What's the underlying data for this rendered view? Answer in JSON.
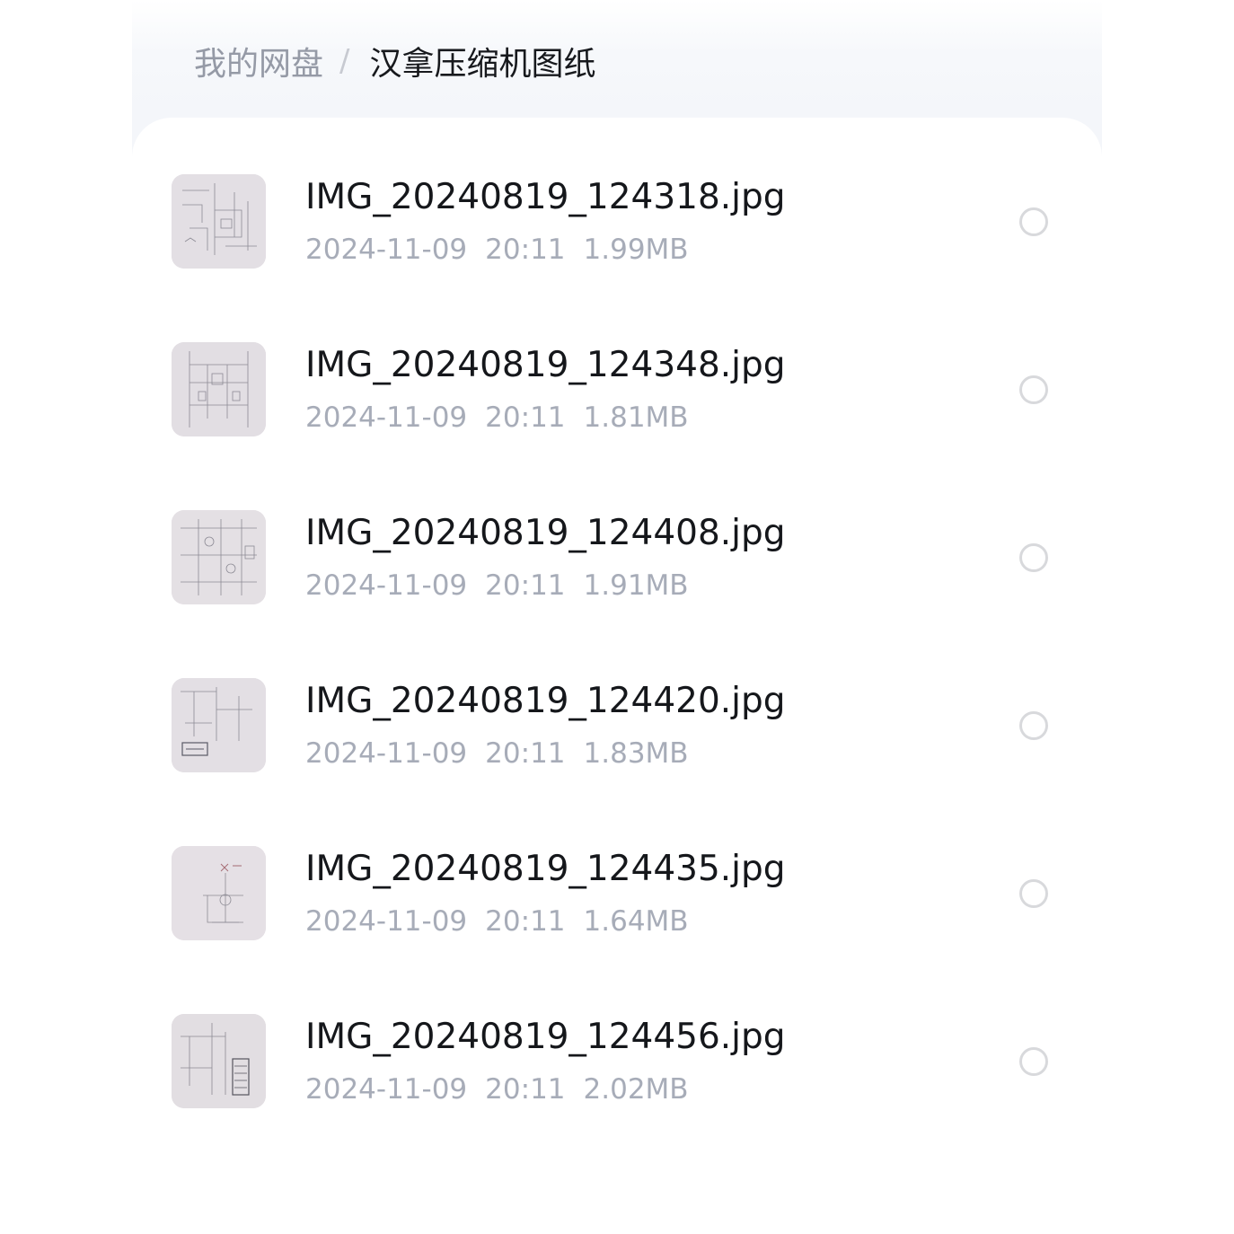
{
  "breadcrumb": {
    "root": "我的网盘",
    "separator": "/",
    "current": "汉拿压缩机图纸"
  },
  "files": [
    {
      "name": "IMG_20240819_124318.jpg",
      "date": "2024-11-09",
      "time": "20:11",
      "size": "1.99MB",
      "thumbnail_icon": "image-thumbnail"
    },
    {
      "name": "IMG_20240819_124348.jpg",
      "date": "2024-11-09",
      "time": "20:11",
      "size": "1.81MB",
      "thumbnail_icon": "image-thumbnail"
    },
    {
      "name": "IMG_20240819_124408.jpg",
      "date": "2024-11-09",
      "time": "20:11",
      "size": "1.91MB",
      "thumbnail_icon": "image-thumbnail"
    },
    {
      "name": "IMG_20240819_124420.jpg",
      "date": "2024-11-09",
      "time": "20:11",
      "size": "1.83MB",
      "thumbnail_icon": "image-thumbnail"
    },
    {
      "name": "IMG_20240819_124435.jpg",
      "date": "2024-11-09",
      "time": "20:11",
      "size": "1.64MB",
      "thumbnail_icon": "image-thumbnail"
    },
    {
      "name": "IMG_20240819_124456.jpg",
      "date": "2024-11-09",
      "time": "20:11",
      "size": "2.02MB",
      "thumbnail_icon": "image-thumbnail"
    }
  ],
  "colors": {
    "primary_text": "#15171b",
    "secondary_text": "#a7acb8",
    "breadcrumb_root": "#959aa6",
    "radio_border": "#d8d9dc"
  }
}
